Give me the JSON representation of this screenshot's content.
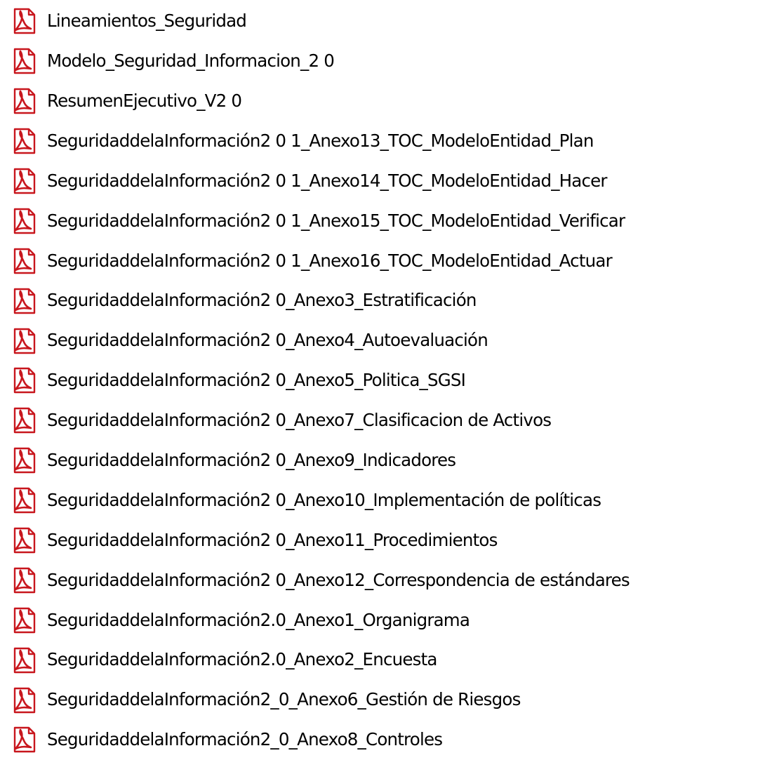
{
  "colors": {
    "text": "#000000",
    "background": "#ffffff",
    "pdf_icon_red": "#c8161d",
    "pdf_icon_page": "#ffffff"
  },
  "icon": "pdf-file-icon",
  "files": [
    {
      "name": "Lineamientos_Seguridad"
    },
    {
      "name": "Modelo_Seguridad_Informacion_2 0"
    },
    {
      "name": "ResumenEjecutivo_V2 0"
    },
    {
      "name": "SeguridaddelaInformación2 0 1_Anexo13_TOC_ModeloEntidad_Plan"
    },
    {
      "name": "SeguridaddelaInformación2 0 1_Anexo14_TOC_ModeloEntidad_Hacer"
    },
    {
      "name": "SeguridaddelaInformación2 0 1_Anexo15_TOC_ModeloEntidad_Verificar"
    },
    {
      "name": "SeguridaddelaInformación2 0 1_Anexo16_TOC_ModeloEntidad_Actuar"
    },
    {
      "name": "SeguridaddelaInformación2 0_Anexo3_Estratificación"
    },
    {
      "name": "SeguridaddelaInformación2 0_Anexo4_Autoevaluación"
    },
    {
      "name": "SeguridaddelaInformación2 0_Anexo5_Politica_SGSI"
    },
    {
      "name": "SeguridaddelaInformación2 0_Anexo7_Clasificacion de Activos"
    },
    {
      "name": "SeguridaddelaInformación2 0_Anexo9_Indicadores"
    },
    {
      "name": "SeguridaddelaInformación2 0_Anexo10_Implementación de políticas"
    },
    {
      "name": "SeguridaddelaInformación2 0_Anexo11_Procedimientos"
    },
    {
      "name": "SeguridaddelaInformación2 0_Anexo12_Correspondencia de estándares"
    },
    {
      "name": "SeguridaddelaInformación2.0_Anexo1_Organigrama"
    },
    {
      "name": "SeguridaddelaInformación2.0_Anexo2_Encuesta"
    },
    {
      "name": "SeguridaddelaInformación2_0_Anexo6_Gestión de Riesgos"
    },
    {
      "name": "SeguridaddelaInformación2_0_Anexo8_Controles"
    }
  ]
}
